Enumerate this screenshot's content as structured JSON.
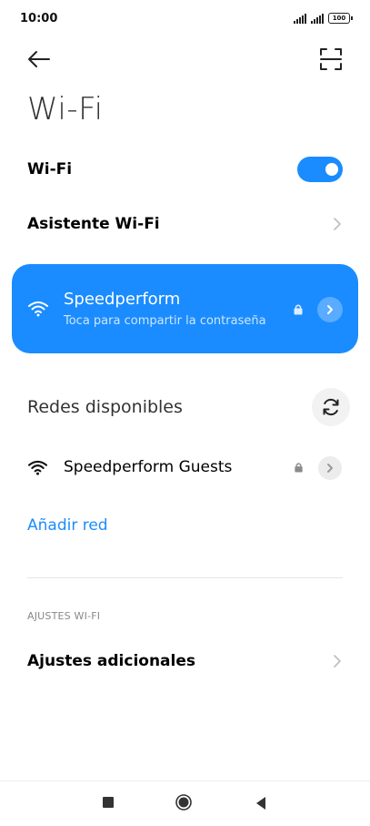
{
  "status_bar": {
    "time": "10:00",
    "battery": "100"
  },
  "header": {
    "back_icon": "back-arrow-icon",
    "scan_icon": "scan-qr-icon"
  },
  "title": "Wi-Fi",
  "wifi_toggle": {
    "label": "Wi-Fi",
    "enabled": true
  },
  "wifi_assistant": {
    "label": "Asistente Wi-Fi"
  },
  "connected_network": {
    "name": "Speedperform",
    "subtitle": "Toca para compartir la contraseña",
    "accent": "#1a8cff"
  },
  "available_networks": {
    "title": "Redes disponibles",
    "items": [
      {
        "name": "Speedperform Guests",
        "secured": true
      }
    ]
  },
  "add_network": {
    "label": "Añadir red"
  },
  "wifi_settings": {
    "header": "AJUSTES WI-FI",
    "additional_settings_label": "Ajustes adicionales"
  }
}
